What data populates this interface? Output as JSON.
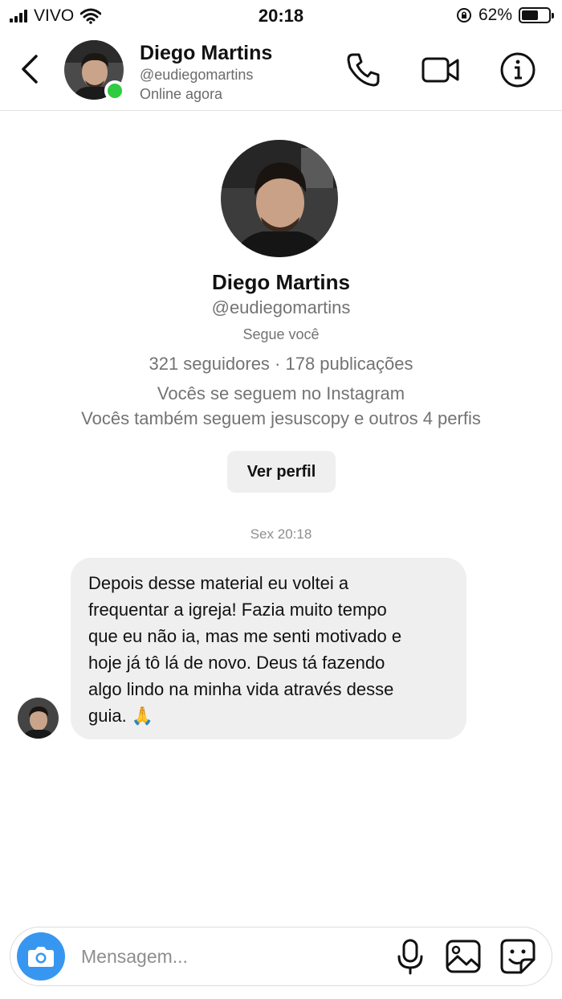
{
  "status_bar": {
    "carrier": "VIVO",
    "time": "20:18",
    "battery_text": "62%",
    "battery_level": 0.62
  },
  "header": {
    "name": "Diego Martins",
    "handle": "@eudiegomartins",
    "status": "Online agora",
    "online_color": "#2ecc40"
  },
  "profile": {
    "name": "Diego Martins",
    "handle": "@eudiegomartins",
    "follows_you": "Segue você",
    "stats": "321 seguidores · 178 publicações",
    "mutual_line1": "Vocês se seguem no Instagram",
    "mutual_line2": "Vocês também seguem jesuscopy e outros 4 perfis",
    "view_profile_label": "Ver perfil"
  },
  "thread": {
    "timestamp": "Sex 20:18",
    "messages": [
      {
        "lines": [
          "Depois desse material eu voltei a",
          "frequentar a igreja! Fazia muito tempo",
          "que eu não ia, mas me senti motivado e",
          "hoje já tô lá de novo. Deus tá fazendo",
          "algo lindo na minha vida através desse",
          "guia. 🙏"
        ]
      }
    ]
  },
  "composer": {
    "placeholder": "Mensagem...",
    "camera_color": "#3797f0"
  },
  "icons": {
    "back": "chevron-left-icon",
    "call": "phone-icon",
    "video": "video-camera-icon",
    "info": "info-icon",
    "camera": "camera-icon",
    "mic": "microphone-icon",
    "gallery": "image-icon",
    "sticker": "sticker-icon"
  }
}
